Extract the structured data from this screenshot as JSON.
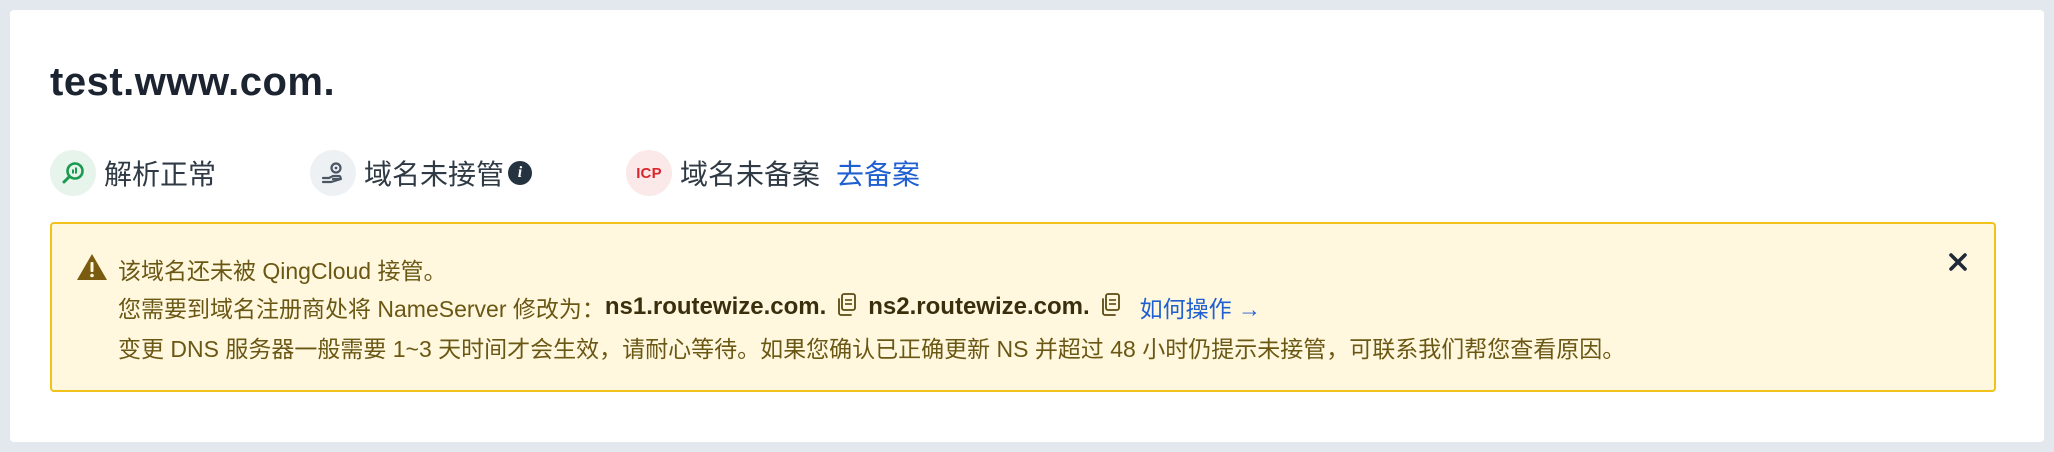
{
  "domain": {
    "name": "test.www.com."
  },
  "status": {
    "resolve_label": "解析正常",
    "hosting_label": "域名未接管",
    "icp_badge": "ICP",
    "icp_label": "域名未备案",
    "icp_action": "去备案"
  },
  "alert": {
    "title": "该域名还未被 QingCloud 接管。",
    "ns_prefix": "您需要到域名注册商处将 NameServer 修改为：",
    "ns1": "ns1.routewize.com.",
    "ns2": "ns2.routewize.com.",
    "howto_link": "如何操作 →",
    "note": "变更 DNS 服务器一般需要 1~3 天时间才会生效，请耐心等待。如果您确认已正确更新 NS 并超过 48 小时仍提示未接管，可联系我们帮您查看原因。"
  },
  "colors": {
    "alert_bg": "#fff8df",
    "alert_border": "#f1c21c",
    "link": "#1f5fd1",
    "status_ok": "#1a9a4f",
    "icp_red": "#d9252b"
  },
  "icons": {
    "resolve": "dns-search-icon",
    "hosting": "hand-gear-icon",
    "info": "info-icon",
    "warning": "warning-icon",
    "close": "close-icon",
    "copy": "copy-icon"
  }
}
